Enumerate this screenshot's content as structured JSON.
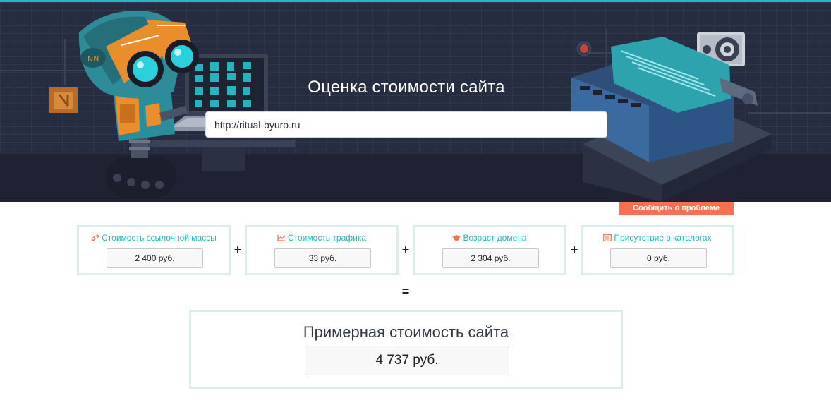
{
  "hero": {
    "title": "Оценка стоимости сайта",
    "url_value": "http://ritual-byuro.ru",
    "accent": "#25b7c4",
    "background": "#252a3b"
  },
  "report_button": {
    "label": "Сообщить о проблеме",
    "color": "#f7704f"
  },
  "metrics": [
    {
      "icon": "link-icon",
      "label": "Стоимость ссылочной массы",
      "value": "2 400 руб."
    },
    {
      "icon": "chart-icon",
      "label": "Стоимость трафика",
      "value": "33 руб."
    },
    {
      "icon": "graduation-cap-icon",
      "label": "Возраст домена",
      "value": "2 304 руб."
    },
    {
      "icon": "catalog-icon",
      "label": "Присутствие в каталогах",
      "value": "0 руб."
    }
  ],
  "operators": {
    "plus": "+",
    "equals": "="
  },
  "result": {
    "title": "Примерная стоимость сайта",
    "value": "4 737 руб."
  },
  "colors": {
    "label_teal": "#29b2c0",
    "icon_coral": "#f7704f",
    "card_border": "#dceceb"
  }
}
